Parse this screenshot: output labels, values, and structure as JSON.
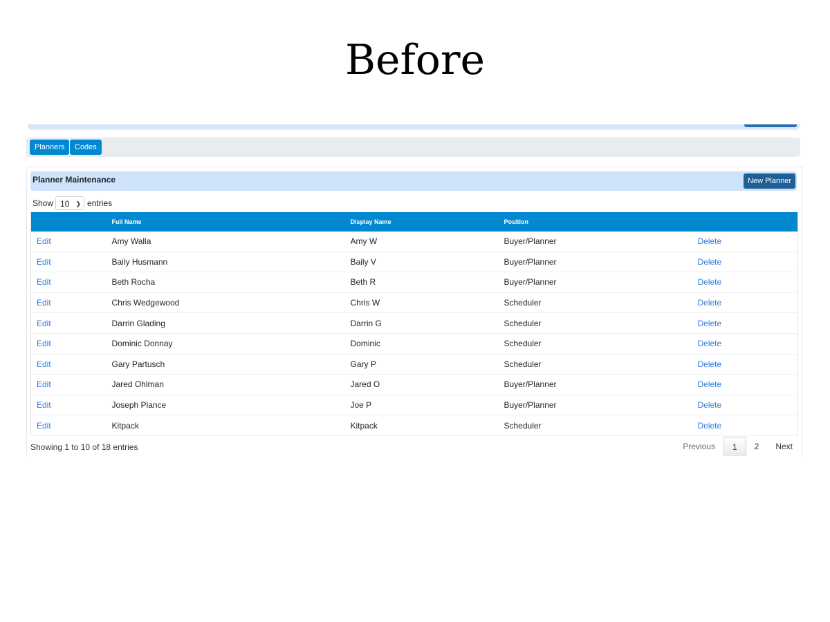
{
  "heading": "Before",
  "nav": {
    "planners_label": "Planners",
    "codes_label": "Codes"
  },
  "card": {
    "title": "Planner Maintenance",
    "new_button": "New Planner"
  },
  "length": {
    "show_label": "Show",
    "value": "10",
    "entries_label": "entries"
  },
  "table": {
    "columns": [
      "",
      "Full Name",
      "Display Name",
      "Position",
      ""
    ],
    "rows": [
      {
        "edit": "Edit",
        "full_name": "Amy Walla",
        "display_name": "Amy W",
        "position": "Buyer/Planner",
        "delete": "Delete"
      },
      {
        "edit": "Edit",
        "full_name": "Baily Husmann",
        "display_name": "Baily V",
        "position": "Buyer/Planner",
        "delete": "Delete"
      },
      {
        "edit": "Edit",
        "full_name": "Beth Rocha",
        "display_name": "Beth R",
        "position": "Buyer/Planner",
        "delete": "Delete"
      },
      {
        "edit": "Edit",
        "full_name": "Chris Wedgewood",
        "display_name": "Chris W",
        "position": "Scheduler",
        "delete": "Delete"
      },
      {
        "edit": "Edit",
        "full_name": "Darrin Glading",
        "display_name": "Darrin G",
        "position": "Scheduler",
        "delete": "Delete"
      },
      {
        "edit": "Edit",
        "full_name": "Dominic Donnay",
        "display_name": "Dominic",
        "position": "Scheduler",
        "delete": "Delete"
      },
      {
        "edit": "Edit",
        "full_name": "Gary Partusch",
        "display_name": "Gary P",
        "position": "Scheduler",
        "delete": "Delete"
      },
      {
        "edit": "Edit",
        "full_name": "Jared Ohlman",
        "display_name": "Jared O",
        "position": "Buyer/Planner",
        "delete": "Delete"
      },
      {
        "edit": "Edit",
        "full_name": "Joseph Plance",
        "display_name": "Joe P",
        "position": "Buyer/Planner",
        "delete": "Delete"
      },
      {
        "edit": "Edit",
        "full_name": "Kitpack",
        "display_name": "Kitpack",
        "position": "Scheduler",
        "delete": "Delete"
      }
    ]
  },
  "info": "Showing 1 to 10 of 18 entries",
  "pagination": {
    "previous": "Previous",
    "pages": [
      "1",
      "2"
    ],
    "current": "1",
    "next": "Next"
  },
  "colors": {
    "primary": "#0288d1",
    "header_bg": "#cfe2fb",
    "new_button": "#1f5f96",
    "link": "#2a7ae2"
  }
}
